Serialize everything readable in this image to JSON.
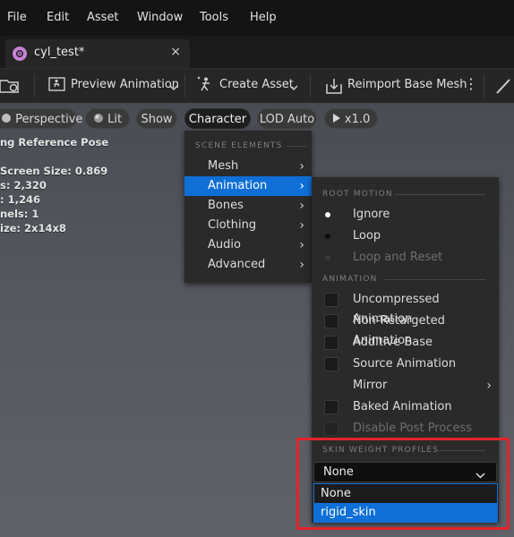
{
  "menubar": {
    "items": [
      "File",
      "Edit",
      "Asset",
      "Window",
      "Tools",
      "Help"
    ]
  },
  "tab": {
    "title": "cyl_test*",
    "close": "×",
    "icon": "skeletal-mesh-icon"
  },
  "toolbar": {
    "preview_animation": "Preview Animation",
    "create_asset": "Create Asset",
    "reimport": "Reimport Base Mesh",
    "more": "⋮"
  },
  "viewport": {
    "perspective": "Perspective",
    "lit": "Lit",
    "show": "Show",
    "character": "Character",
    "lod": "LOD Auto",
    "speed": "x1.0",
    "stats": [
      "ng Reference Pose",
      "",
      "Screen Size: 0.869",
      "s: 2,320",
      ": 1,246",
      "nels: 1",
      "ize: 2x14x8"
    ]
  },
  "character_menu": {
    "section": "SCENE ELEMENTS",
    "items": [
      "Mesh",
      "Animation",
      "Bones",
      "Clothing",
      "Audio",
      "Advanced"
    ],
    "highlighted": "Animation"
  },
  "animation_menu": {
    "root_motion_section": "ROOT MOTION",
    "root_motion": [
      "Ignore",
      "Loop",
      "Loop and Reset"
    ],
    "animation_section": "ANIMATION",
    "animation_items": [
      "Uncompressed Animation",
      "Non-Retargeted Animation",
      "Additive Base",
      "Source Animation",
      "Mirror",
      "Baked Animation",
      "Disable Post Process"
    ],
    "skin_section": "SKIN WEIGHT PROFILES",
    "skin_selected": "None",
    "skin_options": [
      "None",
      "rigid_skin"
    ]
  },
  "colors": {
    "accent": "#0e6fd6",
    "highlight_box": "#e3232b",
    "tab_icon": "#c583d3"
  }
}
